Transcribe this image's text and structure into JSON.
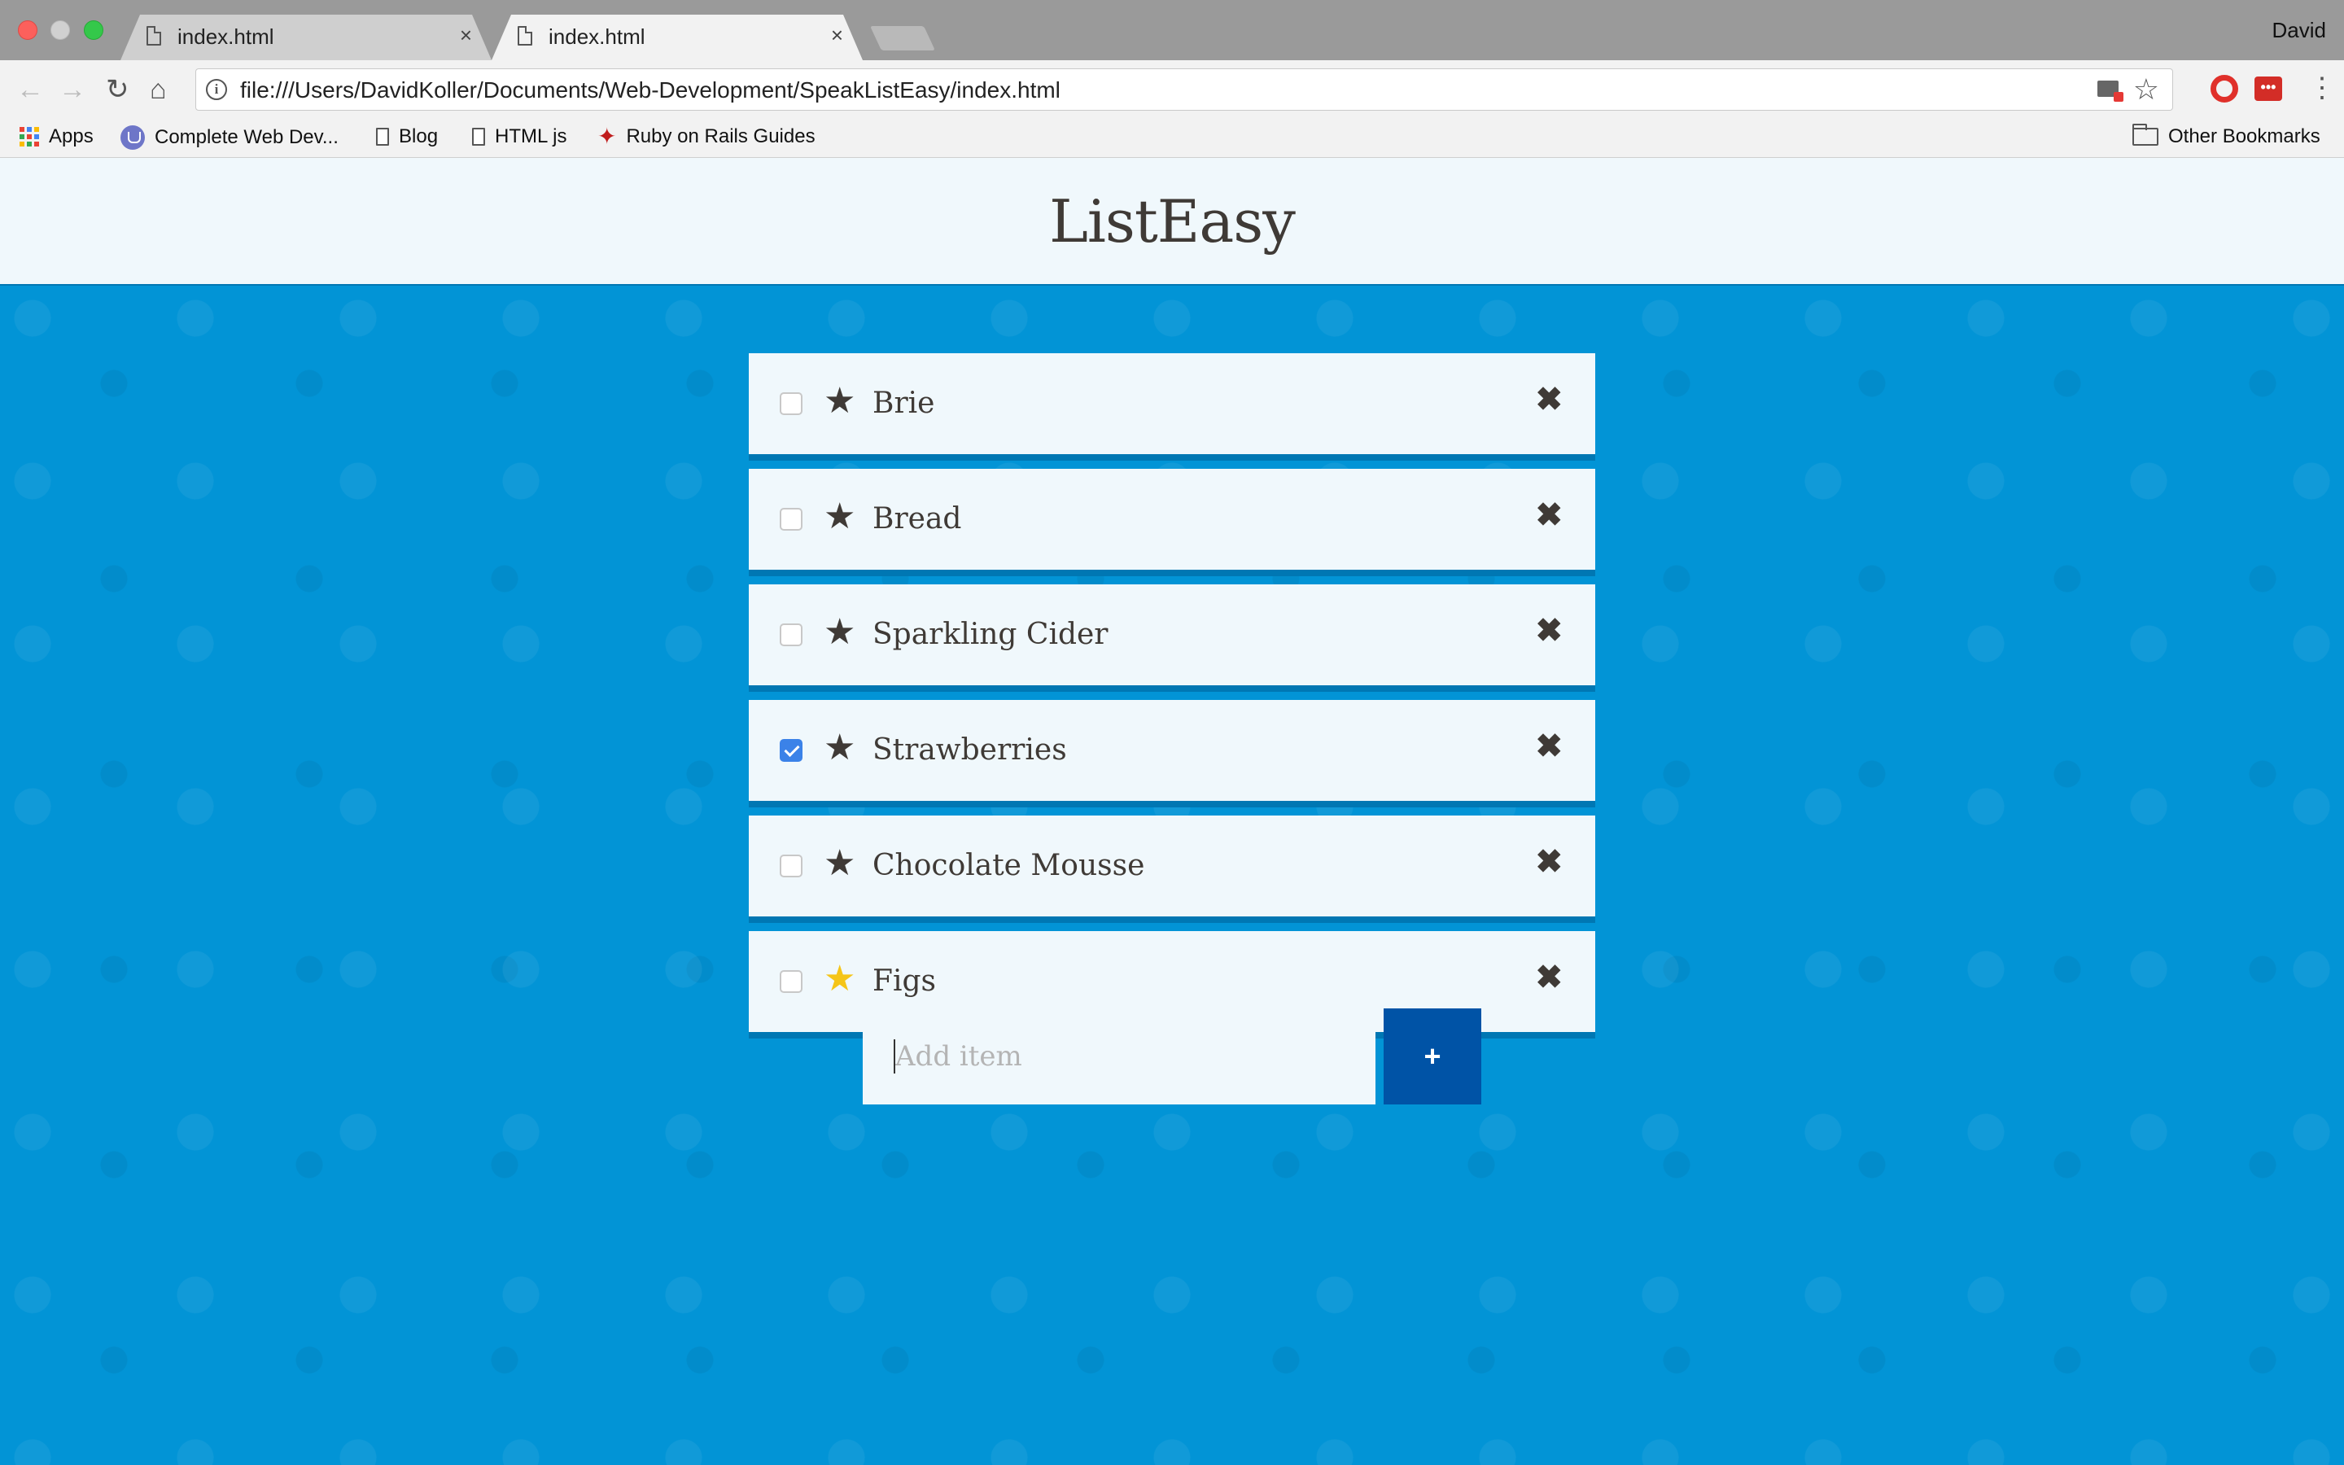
{
  "browser": {
    "tabs": [
      {
        "title": "index.html",
        "active": false
      },
      {
        "title": "index.html",
        "active": true
      }
    ],
    "close_glyph": "×",
    "profile_name": "David",
    "url": "file:///Users/DavidKoller/Documents/Web-Development/SpeakListEasy/index.html",
    "bookmarks": [
      {
        "label": "Apps",
        "icon": "apps-grid-icon"
      },
      {
        "label": "Complete Web Dev...",
        "icon": "udemy-icon"
      },
      {
        "label": "Blog",
        "icon": "page-icon"
      },
      {
        "label": "HTML js",
        "icon": "page-icon"
      },
      {
        "label": "Ruby on Rails Guides",
        "icon": "rails-icon"
      }
    ],
    "other_bookmarks": "Other Bookmarks"
  },
  "app": {
    "title": "ListEasy",
    "items": [
      {
        "label": "Brie",
        "checked": false,
        "starred": false
      },
      {
        "label": "Bread",
        "checked": false,
        "starred": false
      },
      {
        "label": "Sparkling Cider",
        "checked": false,
        "starred": false
      },
      {
        "label": "Strawberries",
        "checked": true,
        "starred": false
      },
      {
        "label": "Chocolate Mousse",
        "checked": false,
        "starred": false
      },
      {
        "label": "Figs",
        "checked": false,
        "starred": true
      }
    ],
    "star_glyph": "★",
    "delete_glyph": "✖",
    "add_placeholder": "Add item",
    "add_button_label": "+"
  },
  "colors": {
    "background": "#0294d6",
    "header_bg": "#f0f8fc",
    "item_border": "#0077b3",
    "text": "#3f3a36",
    "star_active": "#f5c518",
    "add_button": "#0053a6",
    "checkbox_checked": "#3b82e8"
  }
}
